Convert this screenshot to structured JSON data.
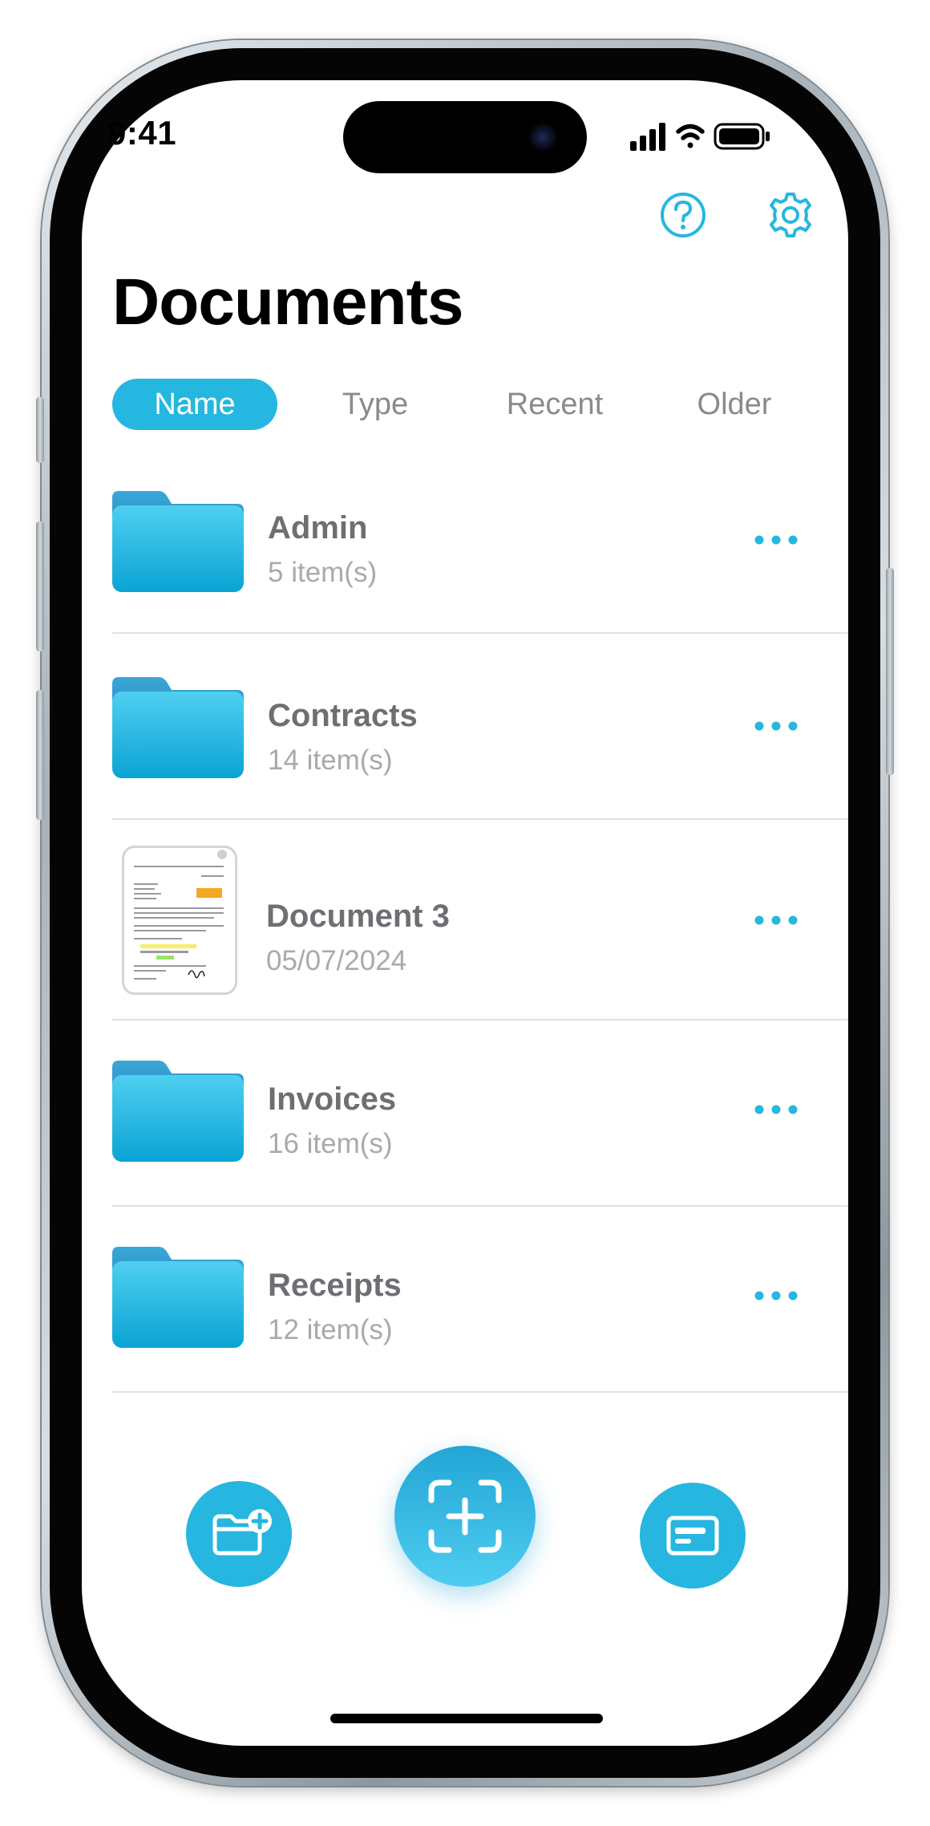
{
  "status_bar": {
    "time": "9:41"
  },
  "header": {
    "title": "Documents"
  },
  "tabs": [
    {
      "label": "Name",
      "active": true
    },
    {
      "label": "Type",
      "active": false
    },
    {
      "label": "Recent",
      "active": false
    },
    {
      "label": "Older",
      "active": false
    }
  ],
  "items": [
    {
      "kind": "folder",
      "title": "Admin",
      "subtitle": "5 item(s)"
    },
    {
      "kind": "folder",
      "title": "Contracts",
      "subtitle": "14 item(s)"
    },
    {
      "kind": "document",
      "title": "Document 3",
      "subtitle": "05/07/2024"
    },
    {
      "kind": "folder",
      "title": "Invoices",
      "subtitle": "16 item(s)"
    },
    {
      "kind": "folder",
      "title": "Receipts",
      "subtitle": "12 item(s)"
    }
  ],
  "icons": {
    "help": "question-circle-icon",
    "settings": "gear-icon",
    "more": "ellipsis-icon",
    "new_folder": "folder-plus-icon",
    "scan": "scan-plus-icon",
    "card": "id-card-icon"
  },
  "colors": {
    "accent": "#25b7e0",
    "folder_top": "#4fcff1",
    "folder_bottom": "#0aa3d4",
    "title_text": "#000000",
    "row_title": "#6e6e73",
    "row_subtitle": "#a9a9ae"
  }
}
